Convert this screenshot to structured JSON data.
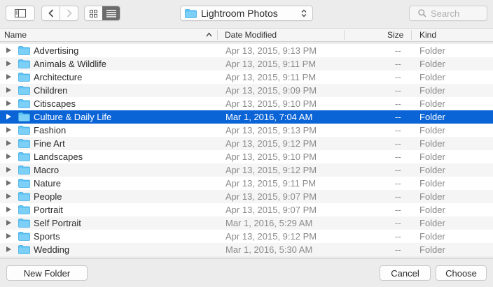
{
  "toolbar": {
    "location_label": "Lightroom Photos",
    "search_placeholder": "Search"
  },
  "columns": {
    "name": "Name",
    "date_modified": "Date Modified",
    "size": "Size",
    "kind": "Kind"
  },
  "rows": [
    {
      "name": "Advertising",
      "date": "Apr 13, 2015, 9:13 PM",
      "size": "--",
      "kind": "Folder"
    },
    {
      "name": "Animals & Wildlife",
      "date": "Apr 13, 2015, 9:11 PM",
      "size": "--",
      "kind": "Folder"
    },
    {
      "name": "Architecture",
      "date": "Apr 13, 2015, 9:11 PM",
      "size": "--",
      "kind": "Folder"
    },
    {
      "name": "Children",
      "date": "Apr 13, 2015, 9:09 PM",
      "size": "--",
      "kind": "Folder"
    },
    {
      "name": "Citiscapes",
      "date": "Apr 13, 2015, 9:10 PM",
      "size": "--",
      "kind": "Folder"
    },
    {
      "name": "Culture & Daily Life",
      "date": "Mar 1, 2016, 7:04 AM",
      "size": "--",
      "kind": "Folder",
      "selected": true
    },
    {
      "name": "Fashion",
      "date": "Apr 13, 2015, 9:13 PM",
      "size": "--",
      "kind": "Folder"
    },
    {
      "name": "Fine Art",
      "date": "Apr 13, 2015, 9:12 PM",
      "size": "--",
      "kind": "Folder"
    },
    {
      "name": "Landscapes",
      "date": "Apr 13, 2015, 9:10 PM",
      "size": "--",
      "kind": "Folder"
    },
    {
      "name": "Macro",
      "date": "Apr 13, 2015, 9:12 PM",
      "size": "--",
      "kind": "Folder"
    },
    {
      "name": "Nature",
      "date": "Apr 13, 2015, 9:11 PM",
      "size": "--",
      "kind": "Folder"
    },
    {
      "name": "People",
      "date": "Apr 13, 2015, 9:07 PM",
      "size": "--",
      "kind": "Folder"
    },
    {
      "name": "Portrait",
      "date": "Apr 13, 2015, 9:07 PM",
      "size": "--",
      "kind": "Folder"
    },
    {
      "name": "Self Portrait",
      "date": "Mar 1, 2016, 5:29 AM",
      "size": "--",
      "kind": "Folder"
    },
    {
      "name": "Sports",
      "date": "Apr 13, 2015, 9:12 PM",
      "size": "--",
      "kind": "Folder"
    },
    {
      "name": "Wedding",
      "date": "Mar 1, 2016, 5:30 AM",
      "size": "--",
      "kind": "Folder"
    }
  ],
  "buttons": {
    "new_folder": "New Folder",
    "cancel": "Cancel",
    "choose": "Choose"
  },
  "colors": {
    "selection": "#0b64d6",
    "folder": "#5ec3f5"
  }
}
